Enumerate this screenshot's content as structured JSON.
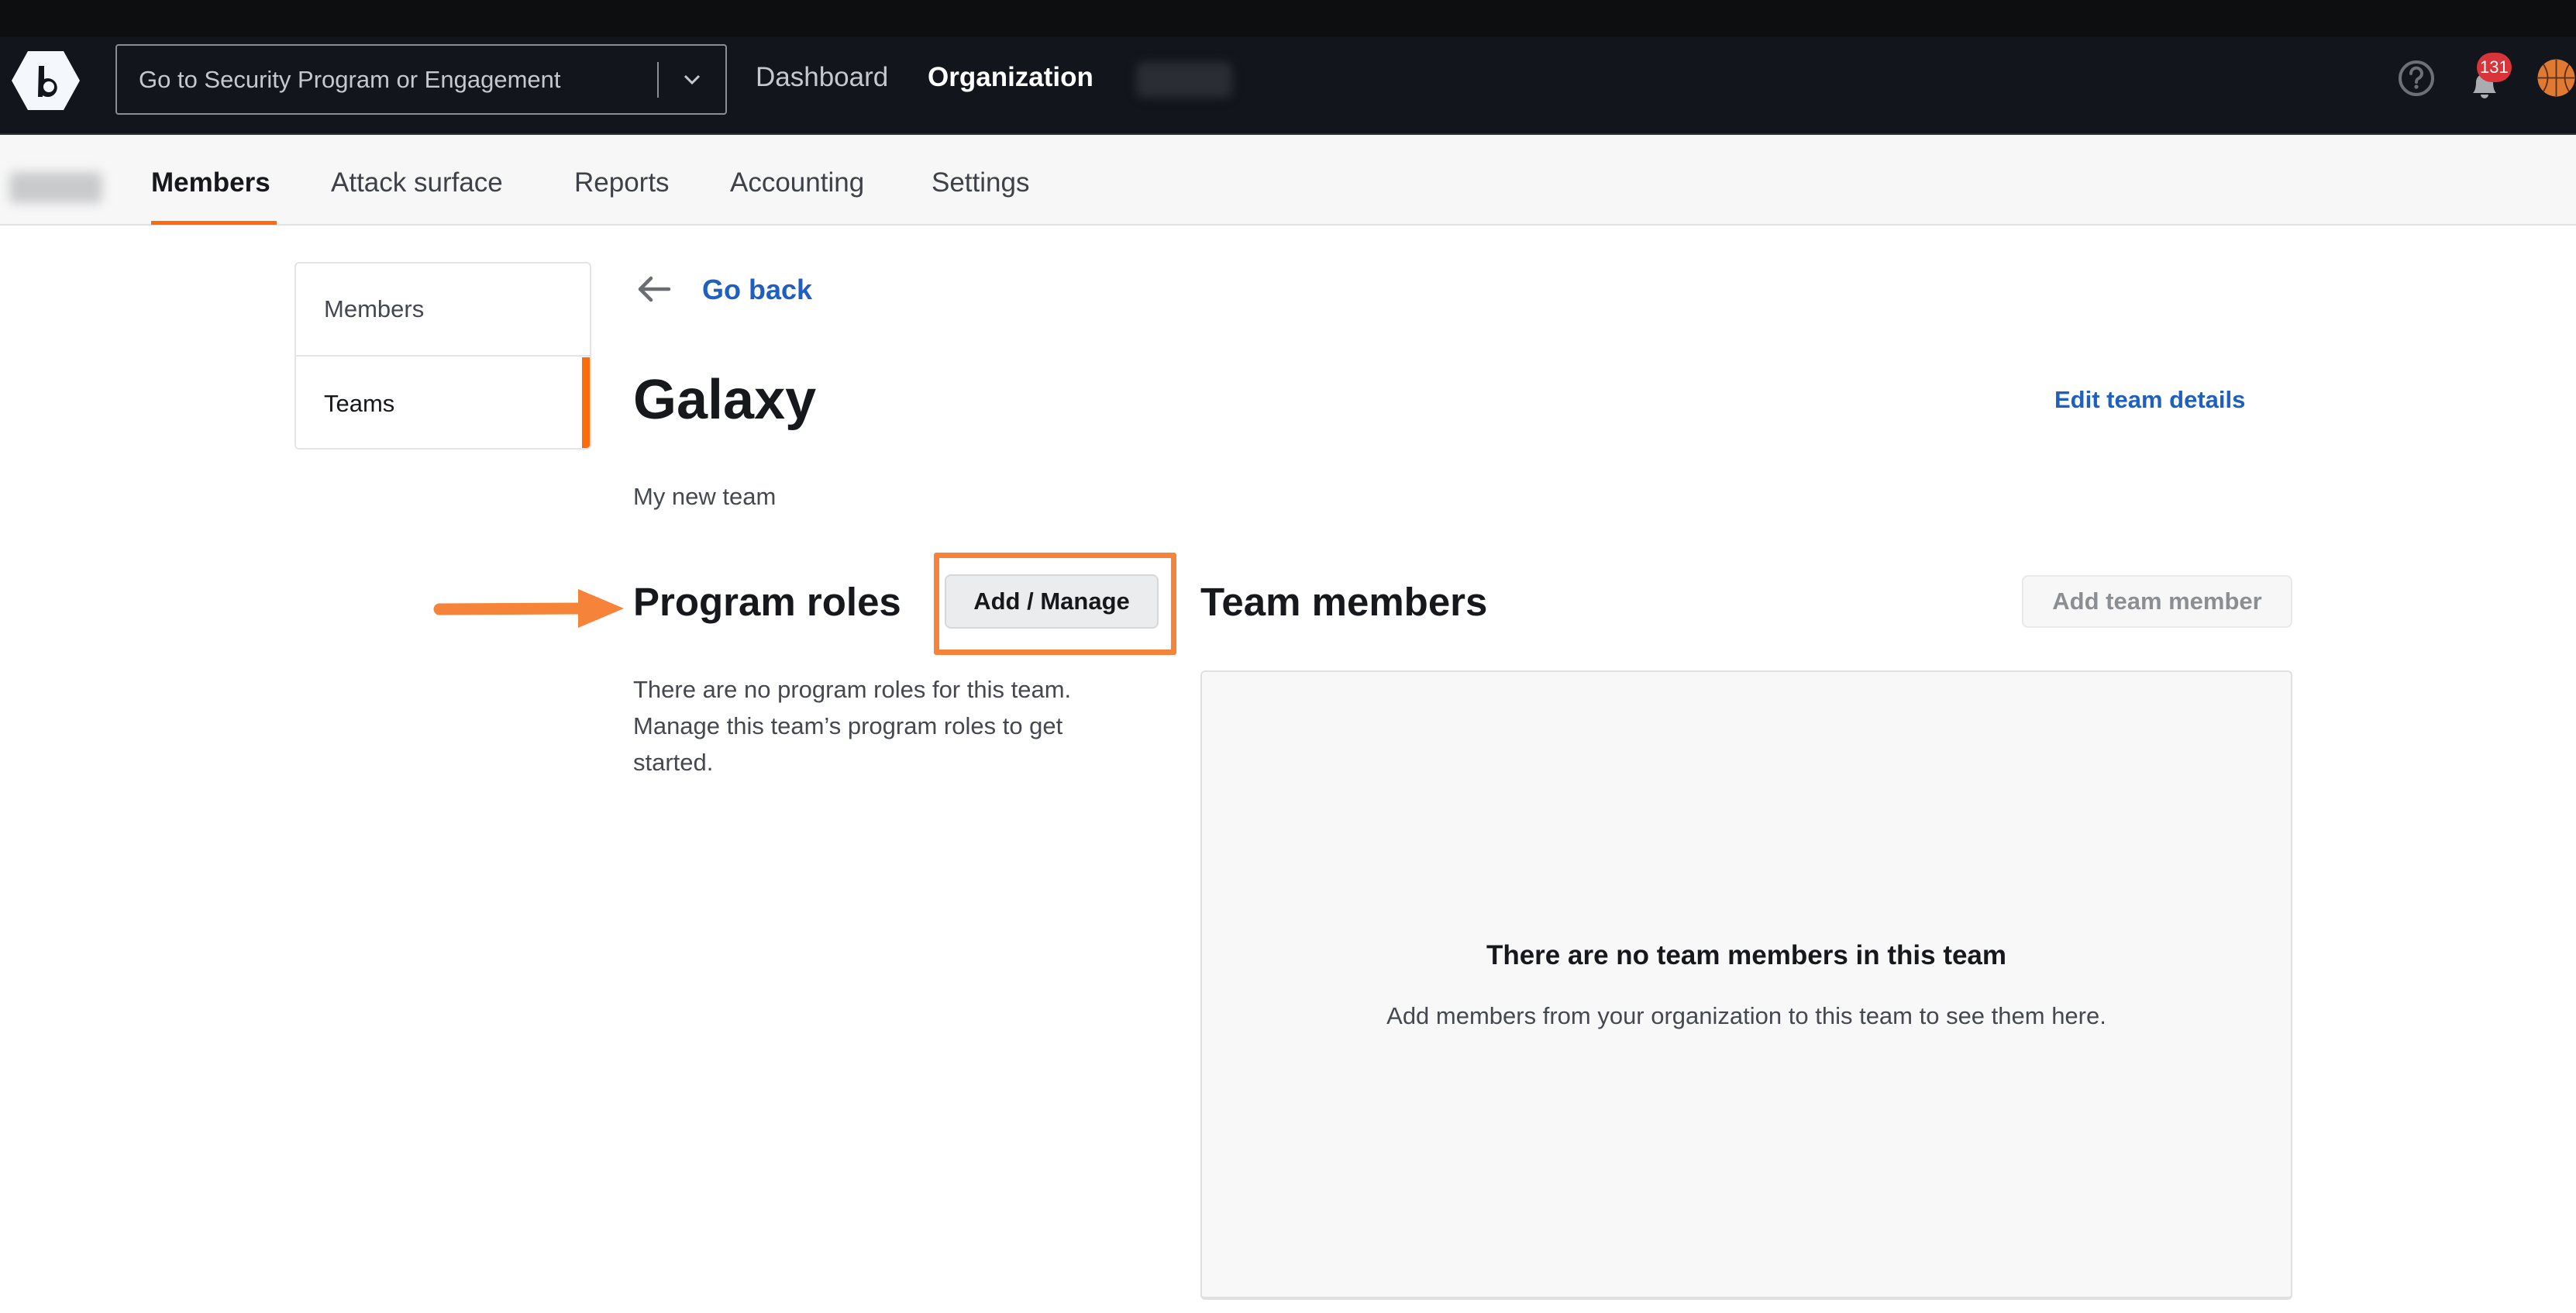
{
  "navbar": {
    "logo_icon": "bugcrowd-logo-icon",
    "program_select": {
      "placeholder": "Go to Security Program or Engagement",
      "chevron_icon": "chevron-down-icon"
    },
    "links": [
      {
        "label": "Dashboard",
        "active": false
      },
      {
        "label": "Organization",
        "active": true
      }
    ],
    "help_icon": "help-circle-icon",
    "notifications": {
      "icon": "bell-icon",
      "count": "131"
    },
    "avatar_icon": "basketball-avatar-icon",
    "colors": {
      "background": "#12151c",
      "badge": "#d8343a"
    }
  },
  "subnav": {
    "tabs": [
      {
        "label": "Members",
        "active": true
      },
      {
        "label": "Attack surface",
        "active": false
      },
      {
        "label": "Reports",
        "active": false
      },
      {
        "label": "Accounting",
        "active": false
      },
      {
        "label": "Settings",
        "active": false
      }
    ],
    "accent_color": "#ff6b0a"
  },
  "sidebar": {
    "items": [
      {
        "label": "Members",
        "active": false
      },
      {
        "label": "Teams",
        "active": true
      }
    ]
  },
  "main": {
    "back_icon": "arrow-left-icon",
    "go_back_label": "Go back",
    "team_name": "Galaxy",
    "edit_team_label": "Edit team details",
    "team_description": "My new team",
    "program_roles": {
      "heading": "Program roles",
      "button_label": "Add / Manage",
      "empty_text": "There are no program roles for this team. Manage this team’s program roles to get started."
    },
    "team_members": {
      "heading": "Team members",
      "button_label": "Add team member",
      "empty_title": "There are no team members in this team",
      "empty_subtitle": "Add members from your organization to this team to see them here."
    },
    "link_color": "#1f5fbf"
  },
  "annotations": {
    "arrow_icon": "annotation-arrow-right-icon",
    "highlight_color": "#f5843a"
  }
}
